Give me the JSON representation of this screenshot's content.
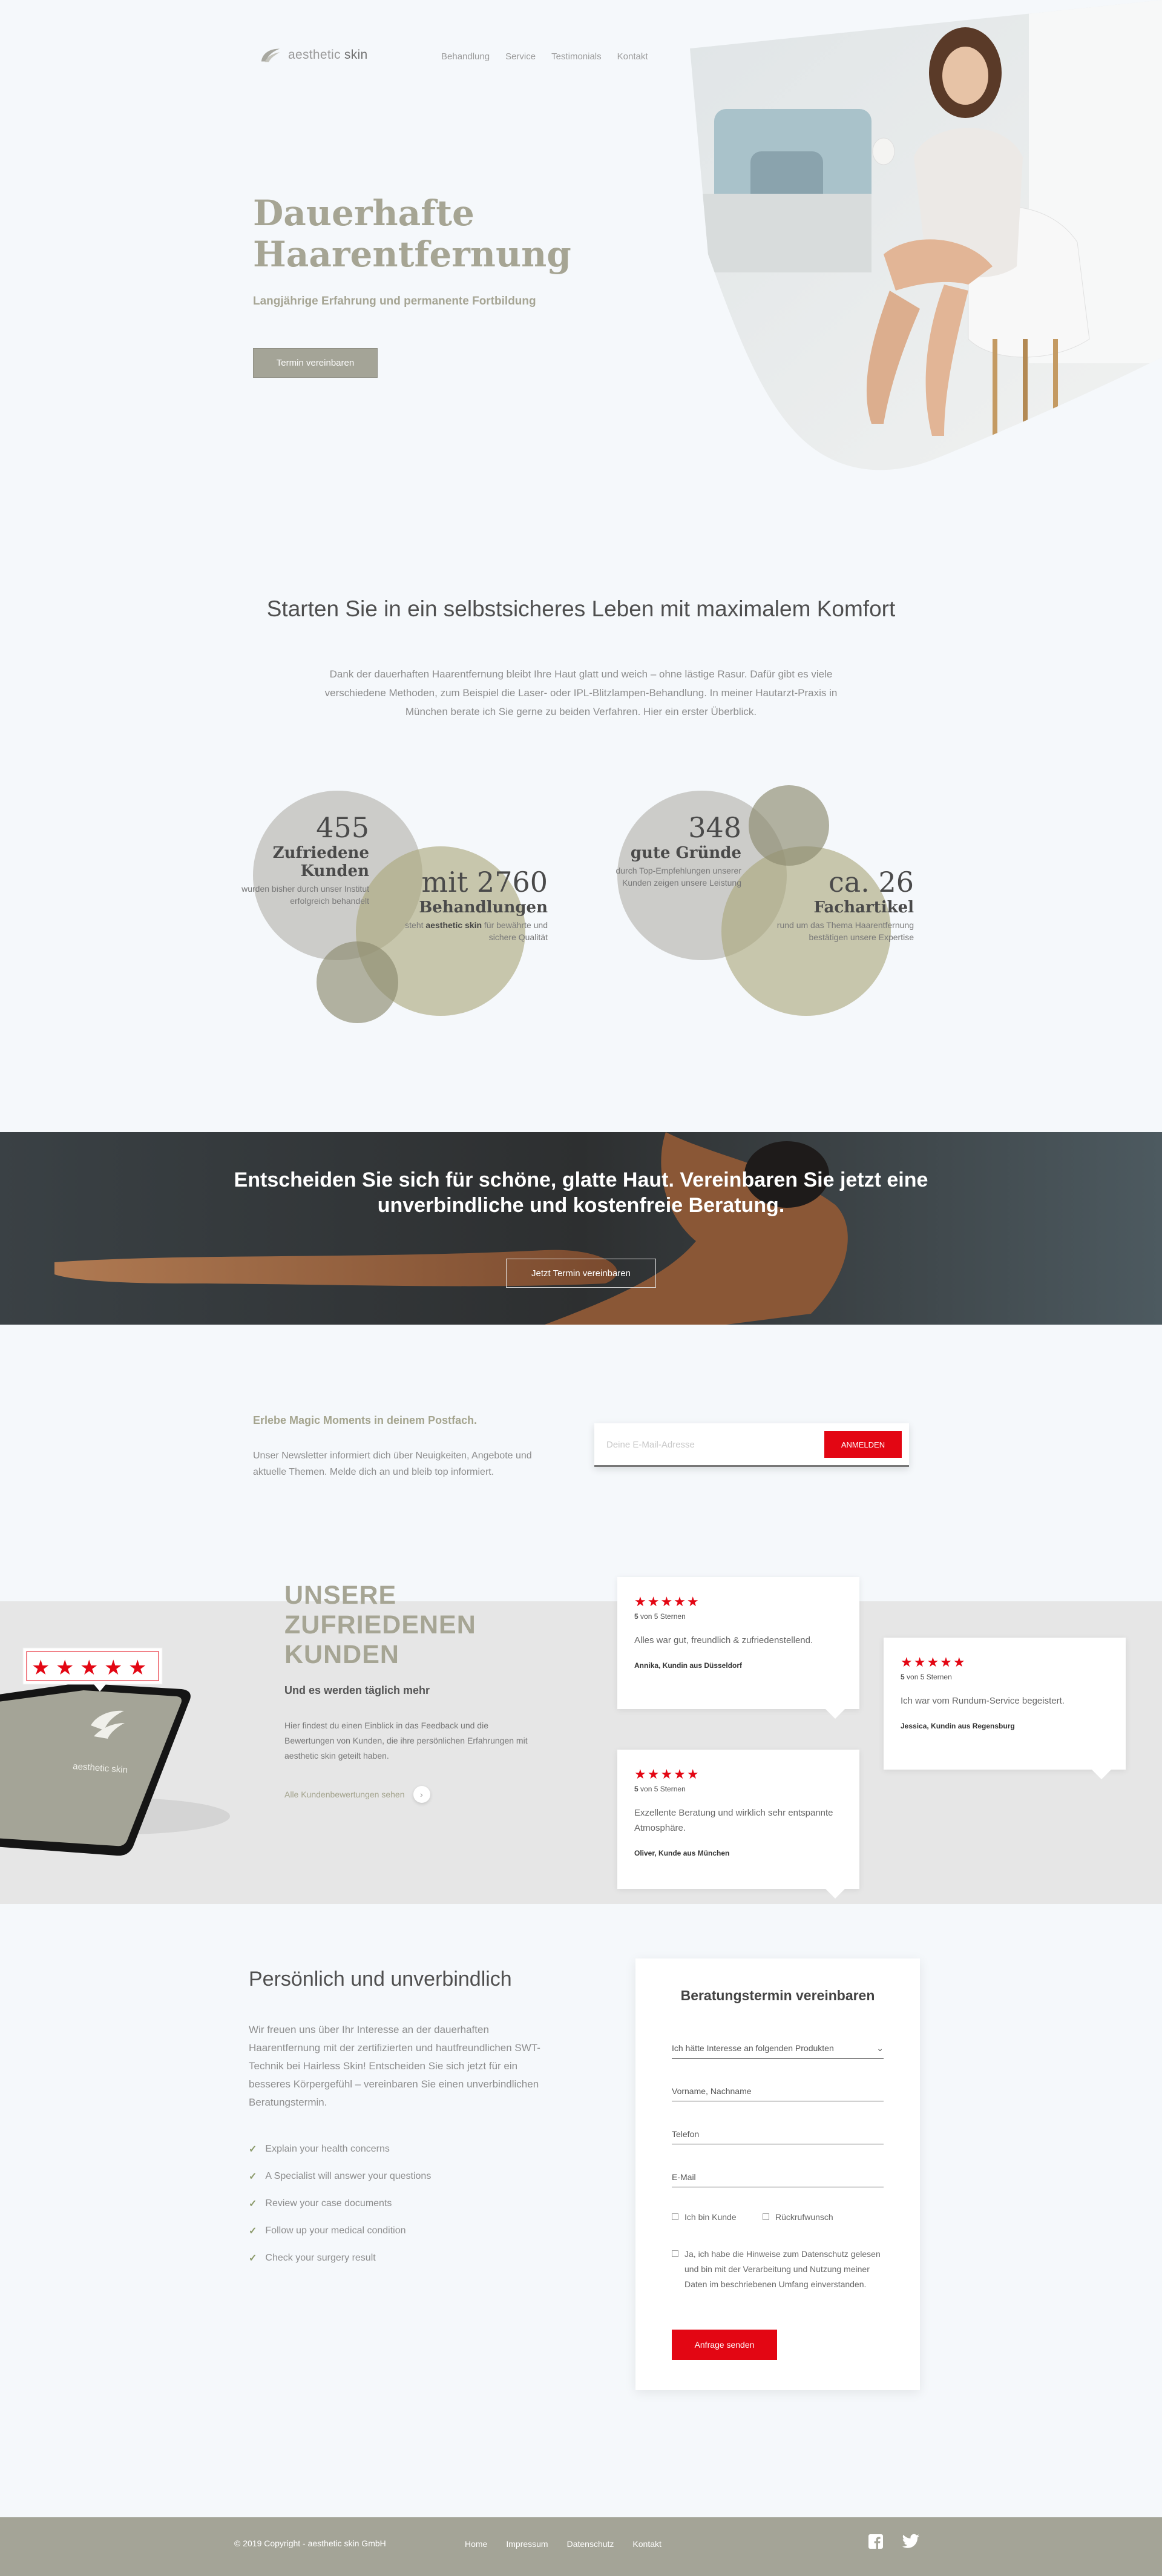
{
  "header": {
    "logo_light": "aesthetic",
    "logo_bold": "skin",
    "nav": [
      "Behandlung",
      "Service",
      "Testimonials",
      "Kontakt"
    ]
  },
  "hero": {
    "title_line1": "Dauerhafte",
    "title_line2": "Haarentfernung",
    "subtitle": "Langjährige Erfahrung und permanente Fortbildung",
    "button": "Termin vereinbaren"
  },
  "intro": {
    "title": "Starten Sie in ein selbstsicheres Leben mit maximalem Komfort",
    "text": "Dank der dauerhaften Haarentfernung bleibt Ihre Haut glatt und weich – ohne lästige Rasur. Dafür gibt es viele verschiedene Methoden, zum Beispiel die Laser- oder IPL-Blitzlampen-Behandlung. In meiner Hautarzt-Praxis in München berate ich Sie gerne zu beiden Verfahren. Hier ein erster Überblick."
  },
  "stats": [
    {
      "num": "455",
      "label": "Zufriedene Kunden",
      "desc1": "wurden bisher durch unser Institut",
      "desc2": "erfolgreich behandelt"
    },
    {
      "num": "mit 2760",
      "label": "Behandlungen",
      "desc1_pre": "steht",
      "desc1_bold": "aesthetic skin",
      "desc1_post": "für bewährte und",
      "desc2": "sichere Qualität"
    },
    {
      "num": "348",
      "label": "gute Gründe",
      "desc1": "durch Top-Empfehlungen unserer",
      "desc2": "Kunden zeigen unsere Leistung"
    },
    {
      "num": "ca. 26",
      "label": "Fachartikel",
      "desc1": "rund um das Thema Haarentfernung",
      "desc2": "bestätigen unsere Expertise"
    }
  ],
  "banner": {
    "text": "Entscheiden Sie sich für schöne, glatte Haut. Vereinbaren Sie jetzt eine unverbindliche und kostenfreie Beratung.",
    "button": "Jetzt Termin vereinbaren"
  },
  "newsletter": {
    "title": "Erlebe Magic Moments in deinem Postfach.",
    "text": "Unser Newsletter informiert dich über Neuigkeiten, Angebote und aktuelle Themen. Melde dich an und bleib top informiert.",
    "placeholder": "Deine E-Mail-Adresse",
    "button": "ANMELDEN"
  },
  "testimonials": {
    "title_line1": "UNSERE",
    "title_line2": "ZUFRIEDENEN",
    "title_line3": "KUNDEN",
    "subtitle": "Und es werden täglich mehr",
    "text": "Hier findest du einen Einblick in das Feedback und die Bewertungen von Kunden, die ihre persönlichen Erfahrungen mit aesthetic skin geteilt haben.",
    "link": "Alle Kundenbewertungen sehen",
    "phone_logo": "aesthetic skin",
    "phone_stars": 5,
    "reviews": [
      {
        "stars": "★★★★★",
        "rating_num": "5",
        "rating_text": "von 5 Sternen",
        "quote": "Alles war gut, freundlich & zufriedenstellend.",
        "author": "Annika, Kundin aus Düsseldorf"
      },
      {
        "stars": "★★★★★",
        "rating_num": "5",
        "rating_text": "von 5 Sternen",
        "quote": "Ich war vom Rundum-Service begeistert.",
        "author": "Jessica, Kundin aus Regensburg"
      },
      {
        "stars": "★★★★★",
        "rating_num": "5",
        "rating_text": "von 5 Sternen",
        "quote": "Exzellente Beratung und wirklich sehr entspannte Atmosphäre.",
        "author": "Oliver, Kunde aus München"
      }
    ]
  },
  "contact": {
    "title": "Persönlich und unverbindlich",
    "text": "Wir freuen uns über Ihr Interesse an der dauerhaften Haarentfernung mit der zertifizierten und hautfreundlichen SWT-Technik bei Hairless Skin! Entscheiden Sie sich jetzt für ein besseres Körpergefühl – vereinbaren Sie einen unverbindlichen Beratungstermin.",
    "list": [
      "Explain your health concerns",
      "A Specialist will answer your questions",
      "Review your case documents",
      "Follow up your medical condition",
      "Check your surgery result"
    ],
    "form": {
      "title": "Beratungstermin vereinbaren",
      "select": "Ich hätte Interesse an folgenden Produkten",
      "name": "Vorname, Nachname",
      "phone": "Telefon",
      "email": "E-Mail",
      "check1": "Ich bin Kunde",
      "check2": "Rückrufwunsch",
      "privacy": "Ja, ich habe die Hinweise zum Datenschutz gelesen und bin mit der Verarbeitung und Nutzung meiner Daten im beschriebenen Umfang einverstanden.",
      "button": "Anfrage senden"
    }
  },
  "footer": {
    "copyright": "© 2019 Copyright - aesthetic skin GmbH",
    "links": [
      "Home",
      "Impressum",
      "Datenschutz",
      "Kontakt"
    ],
    "social": [
      "facebook-icon",
      "twitter-icon"
    ]
  },
  "colors": {
    "accent": "#a4a497",
    "title": "#a6a594",
    "red": "#e30613",
    "background": "#f5f8fb"
  }
}
